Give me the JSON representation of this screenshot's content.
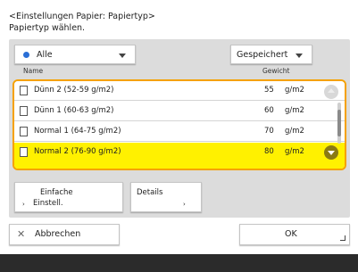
{
  "header": {
    "breadcrumb": "<Einstellungen Papier: Papiertyp>",
    "instruction": "Papiertyp wählen."
  },
  "filter": {
    "value": "Alle"
  },
  "sort": {
    "value": "Gespeichert"
  },
  "columns": {
    "name": "Name",
    "weight": "Gewicht"
  },
  "rows": [
    {
      "name": "Dünn 2 (52-59 g/m2)",
      "weight": "55",
      "unit": "g/m2"
    },
    {
      "name": "Dünn 1 (60-63 g/m2)",
      "weight": "60",
      "unit": "g/m2"
    },
    {
      "name": "Normal 1 (64-75 g/m2)",
      "weight": "70",
      "unit": "g/m2"
    },
    {
      "name": "Normal 2 (76-90 g/m2)",
      "weight": "80",
      "unit": "g/m2"
    }
  ],
  "selected_row_index": 3,
  "actions": {
    "simple_line1": "Einfache",
    "simple_line2": "Einstell.",
    "details": "Details"
  },
  "footer": {
    "cancel": "Abbrechen",
    "ok": "OK"
  },
  "colors": {
    "highlight": "#fff100",
    "frame": "#f5a100",
    "accent_dot": "#2a6fd6"
  }
}
